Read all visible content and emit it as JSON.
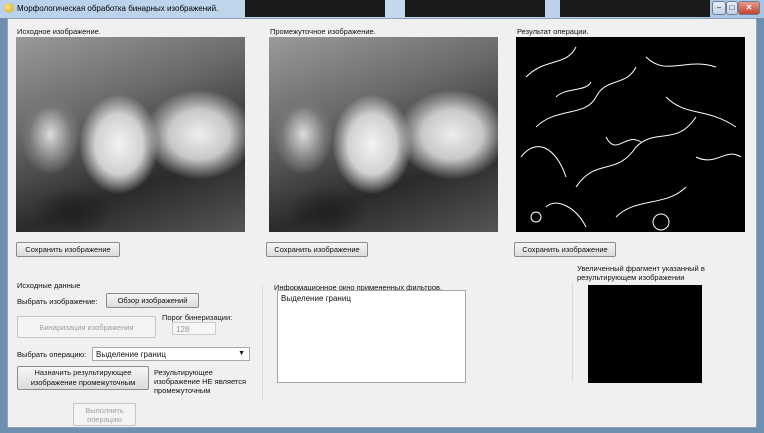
{
  "window": {
    "title": "Морфологическая обработка бинарных изображений.",
    "minimize": "–",
    "maximize": "□",
    "close": "✕"
  },
  "panels": {
    "source": {
      "label": "Исходное изображение.",
      "save": "Сохранить изображение"
    },
    "intermediate": {
      "label": "Промежуточное изображение.",
      "save": "Сохранить изображение"
    },
    "result": {
      "label": "Результат операции.",
      "save": "Сохранить изображение"
    }
  },
  "input": {
    "heading": "Исходные данные",
    "choose_image_label": "Выбрать изображение:",
    "browse_button": "Обзор изображений",
    "binarize_button": "Бинаризация изображения",
    "threshold_label": "Порог бинеризации:",
    "threshold_value": "128",
    "operation_label": "Выбрать операцию:",
    "operation_value": "Выделение границ",
    "assign_button": "Назначить результирующее изображение промежуточным",
    "status_text": "Результирующее изображение НЕ является промежуточным",
    "execute_button": "Выполнить операцию"
  },
  "info": {
    "label": "Информационное окно примененных фильтров.",
    "lines": [
      "Выделение границ"
    ]
  },
  "zoom": {
    "label": "Увеличенный фрагмент указанный в результирующем изображении"
  }
}
